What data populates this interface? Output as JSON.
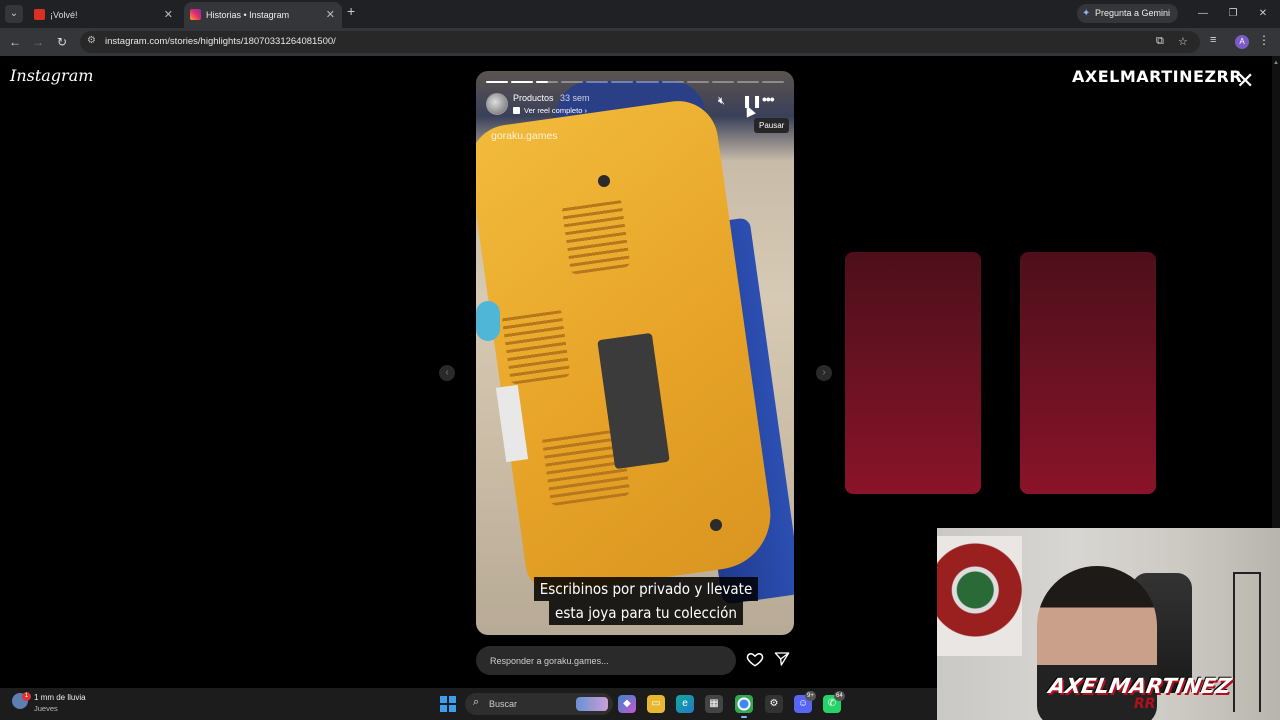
{
  "browser": {
    "tabs": [
      {
        "title": "¡Volvé!",
        "favicon_color": "#d93025",
        "active": false
      },
      {
        "title": "Historias • Instagram",
        "favicon_color": "#e1306c",
        "active": true
      }
    ],
    "gemini_label": "Pregunta a Gemini",
    "url": "instagram.com/stories/highlights/18070331264081500/",
    "profile_initial": "A"
  },
  "page": {
    "logo": "Instagram",
    "wordmark": "AXELMARTINEZRR",
    "story": {
      "username": "Productos",
      "time_ago": "33 sem",
      "reel_link": "Ver reel completo",
      "watermark": "goraku.games",
      "caption_line1": "Escribinos por privado y llevate",
      "caption_line2": "esta joya para tu colección",
      "tooltip": "Pausar",
      "segments_total": 12,
      "segments_complete": 2,
      "current_segment_progress": 0.55
    },
    "reply_placeholder": "Responder a goraku.games..."
  },
  "webcam": {
    "brand_line1": "AXELMARTINEZ",
    "brand_line2": "RR"
  },
  "taskbar": {
    "weather_line1": "1 mm de lluvia",
    "weather_line2": "Jueves",
    "weather_badge": "1",
    "search_label": "Buscar",
    "badges": {
      "discord": "9+",
      "whatsapp": "64"
    }
  },
  "colors": {
    "preview_card": "#6a1222",
    "accent_blue": "#3aa0ef"
  }
}
